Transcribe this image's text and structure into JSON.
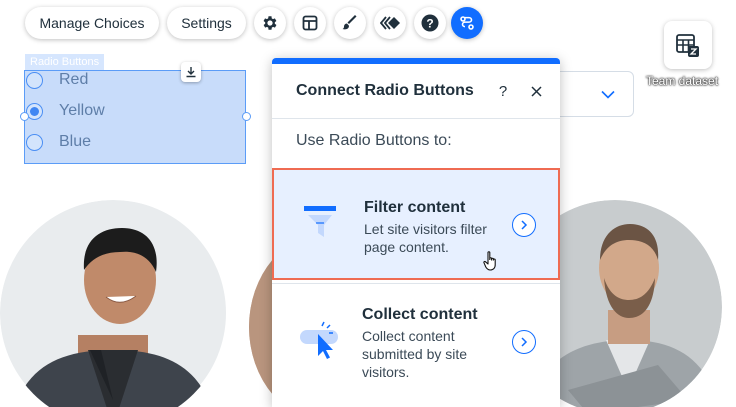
{
  "toolbar": {
    "manage_choices": "Manage Choices",
    "settings": "Settings",
    "icons": [
      "gear-icon",
      "layout-icon",
      "design-brush-icon",
      "animation-icon",
      "help-icon",
      "connect-data-icon"
    ],
    "active_color": "#116dff"
  },
  "radio_widget": {
    "tag": "Radio Buttons",
    "options": [
      {
        "label": "Red",
        "selected": false
      },
      {
        "label": "Yellow",
        "selected": true
      },
      {
        "label": "Blue",
        "selected": false
      }
    ]
  },
  "dataset": {
    "label": "Team dataset"
  },
  "panel": {
    "title": "Connect Radio Buttons",
    "help": "?",
    "subtitle": "Use Radio Buttons to:",
    "options": [
      {
        "title": "Filter content",
        "description": "Let site visitors filter page content.",
        "icon": "filter-funnel-icon",
        "highlighted": true
      },
      {
        "title": "Collect content",
        "description": "Collect content submitted by site visitors.",
        "icon": "collect-click-icon",
        "highlighted": false
      }
    ],
    "highlight_color": "#ef6b52",
    "accent_color": "#116dff"
  }
}
